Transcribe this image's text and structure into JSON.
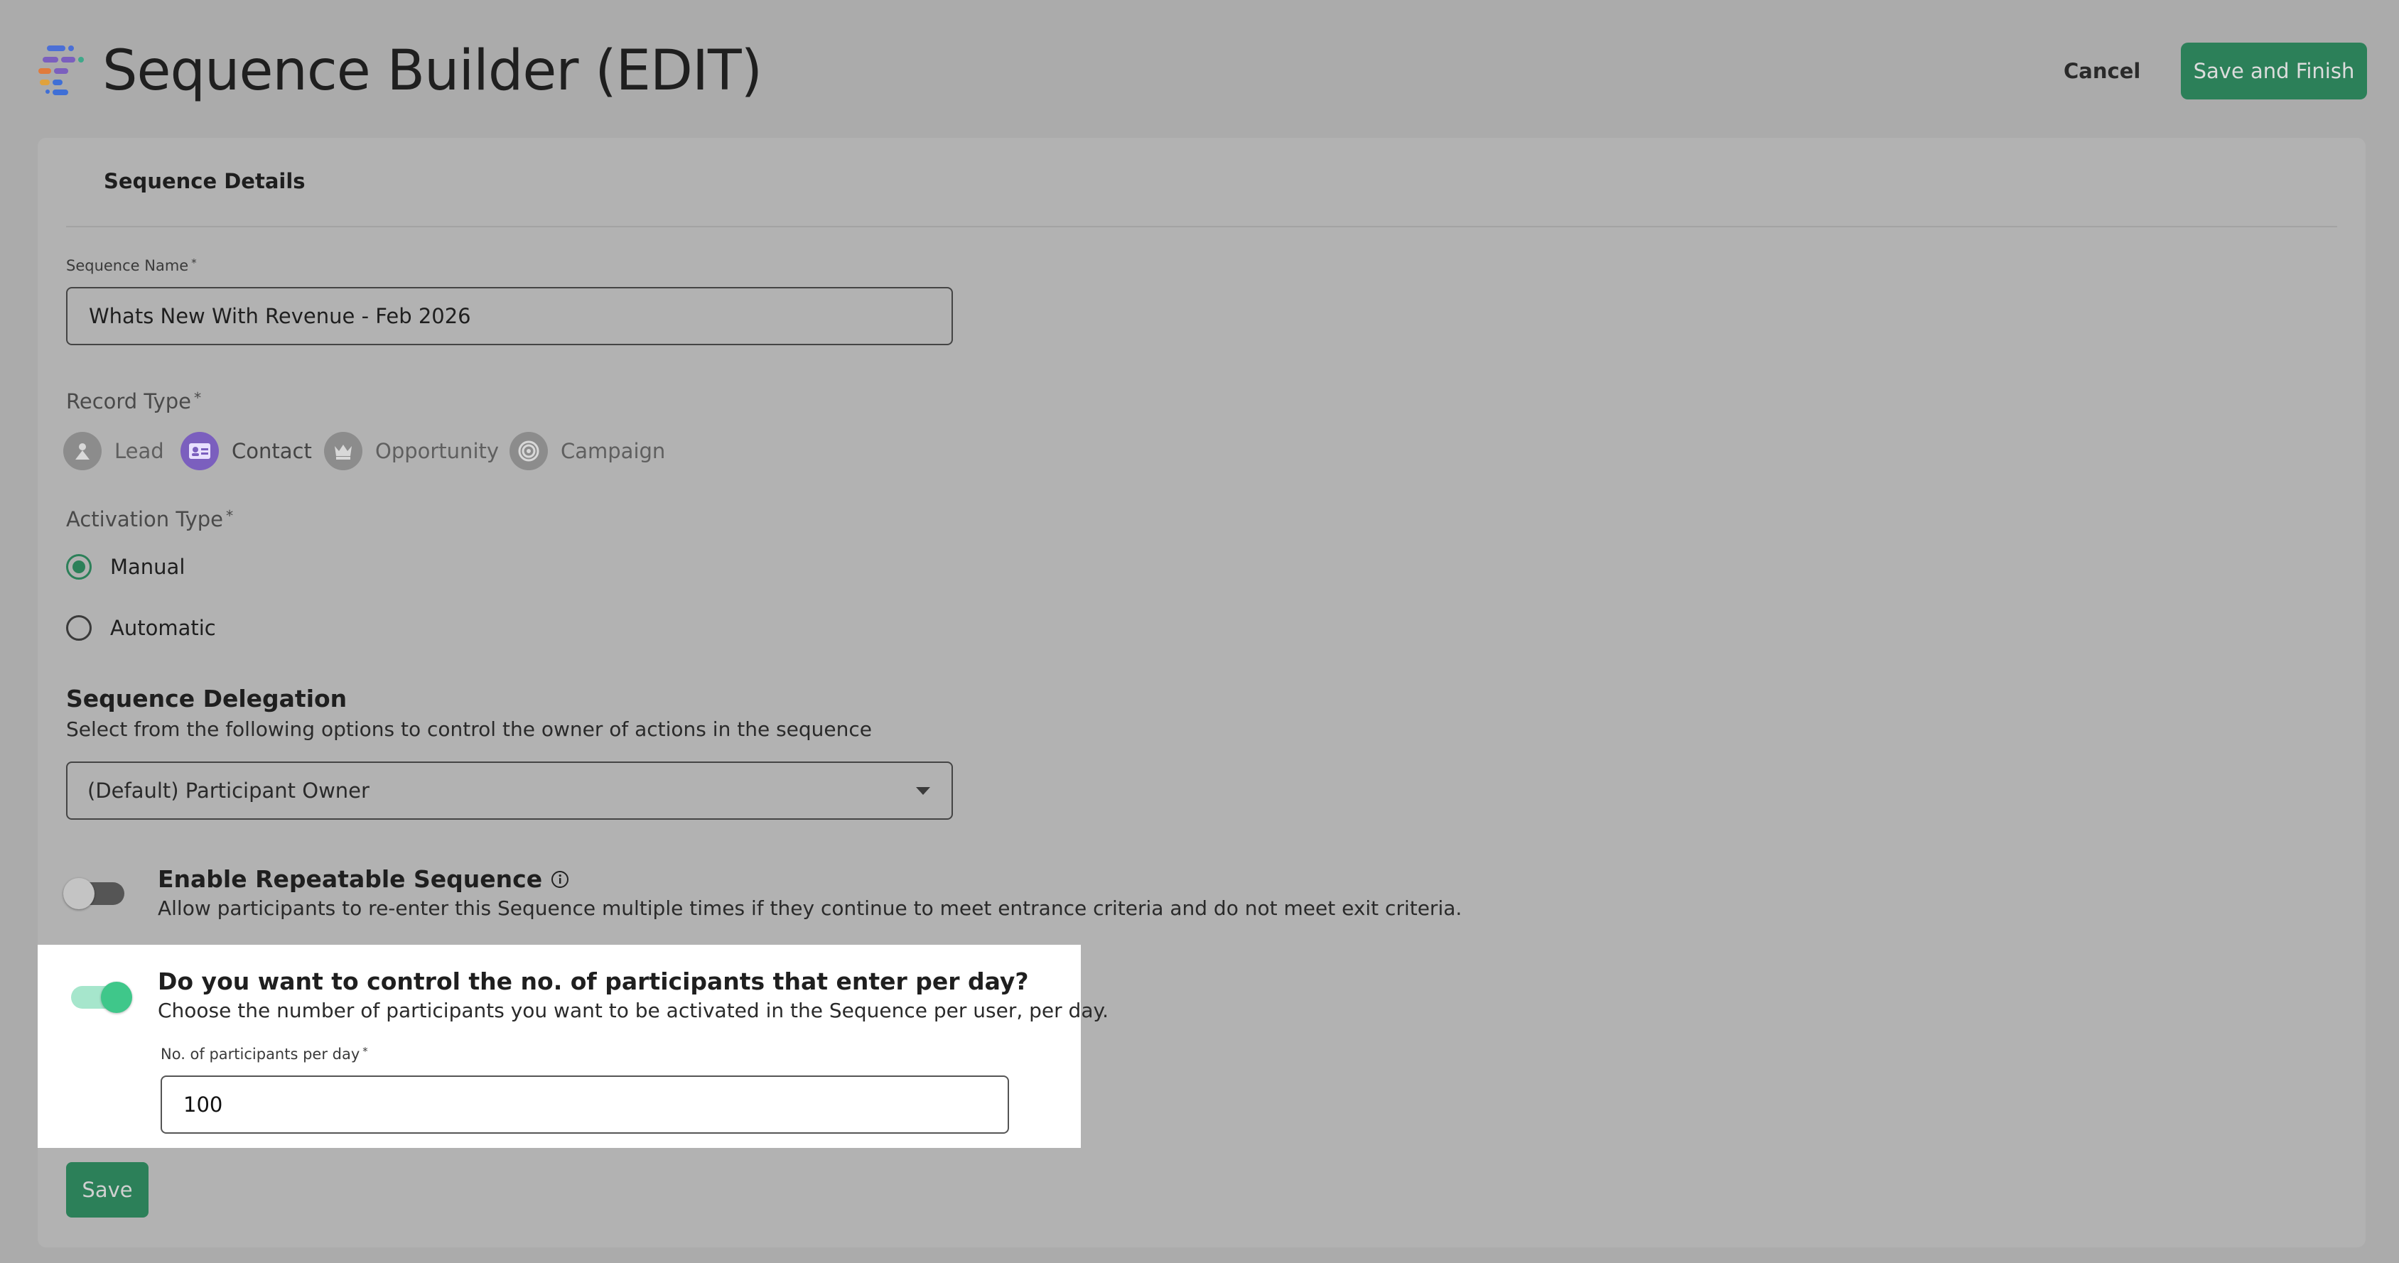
{
  "header": {
    "title": "Sequence Builder (EDIT)",
    "cancel_label": "Cancel",
    "save_finish_label": "Save and Finish"
  },
  "card": {
    "title": "Sequence Details"
  },
  "sequence_name": {
    "label": "Sequence Name",
    "required_mark": "*",
    "value": "Whats New With Revenue - Feb 2026"
  },
  "record_type": {
    "label": "Record Type",
    "required_mark": "*",
    "options": [
      {
        "label": "Lead",
        "icon": "lead-icon",
        "selected": false
      },
      {
        "label": "Contact",
        "icon": "contact-card-icon",
        "selected": true
      },
      {
        "label": "Opportunity",
        "icon": "crown-icon",
        "selected": false
      },
      {
        "label": "Campaign",
        "icon": "target-icon",
        "selected": false
      }
    ]
  },
  "activation_type": {
    "label": "Activation Type",
    "required_mark": "*",
    "options": [
      {
        "label": "Manual",
        "selected": true
      },
      {
        "label": "Automatic",
        "selected": false
      }
    ]
  },
  "delegation": {
    "heading": "Sequence Delegation",
    "description": "Select from the following options to control the owner of actions in the sequence",
    "selected": "(Default) Participant Owner"
  },
  "repeatable": {
    "title": "Enable Repeatable Sequence",
    "description": "Allow participants to re-enter this Sequence multiple times if they continue to meet entrance criteria and do not meet exit criteria.",
    "enabled": false
  },
  "daily_limit": {
    "title": "Do you want to control the no. of participants that enter per day?",
    "description": "Choose the number of participants you want to be activated in the Sequence per user, per day.",
    "enabled": true,
    "field_label": "No. of participants per day",
    "required_mark": "*",
    "value": "100"
  },
  "footer": {
    "save_label": "Save"
  },
  "colors": {
    "accent_green": "#2c8059",
    "toggle_on": "#3fc78a",
    "contact_purple": "#7b5fbe"
  }
}
